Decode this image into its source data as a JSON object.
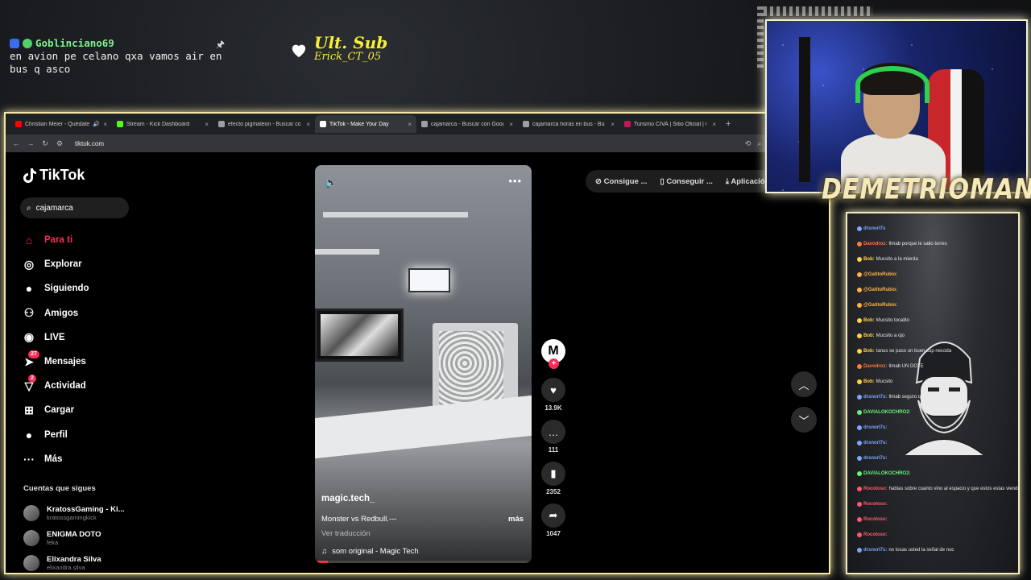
{
  "overlay": {
    "top_chat": {
      "username": "Goblinciano69",
      "message": "en avion pe celano qxa vamos air en bus q asco",
      "pin": "🖈"
    },
    "ult_sub": {
      "title": "Ult. Sub",
      "name": "Erick_CT_05"
    },
    "streamer_name": "DEMETRIOMAN",
    "streamer_suffix": "...."
  },
  "browser": {
    "tabs": [
      {
        "label": "Christian Meier - Quédate",
        "fav_color": "#ff0000",
        "active": false,
        "audio": "🔊"
      },
      {
        "label": "Stream - Kick Dashboard",
        "fav_color": "#53fc18",
        "active": false
      },
      {
        "label": "efecto pigmaleon - Buscar con",
        "fav_color": "#9aa0a6",
        "active": false
      },
      {
        "label": "TikTok - Make Your Day",
        "fav_color": "#ffffff",
        "active": true
      },
      {
        "label": "cajamarca - Buscar con Google",
        "fav_color": "#9aa0a6",
        "active": false
      },
      {
        "label": "cajamarca horas en bus - Busc",
        "fav_color": "#9aa0a6",
        "active": false
      },
      {
        "label": "Turismo CIVA | Sitio Oficial | Co",
        "fav_color": "#c2185b",
        "active": false
      }
    ],
    "new_tab": "+",
    "url": "tiktok.com"
  },
  "tiktok": {
    "logo": "TikTok",
    "search_value": "cajamarca",
    "nav": [
      {
        "label": "Para ti",
        "icon": "home-icon",
        "glyph": "⌂",
        "active": true
      },
      {
        "label": "Explorar",
        "icon": "compass-icon",
        "glyph": "◎"
      },
      {
        "label": "Siguiendo",
        "icon": "following-avatar-icon",
        "glyph": "●"
      },
      {
        "label": "Amigos",
        "icon": "friends-icon",
        "glyph": "⚇"
      },
      {
        "label": "LIVE",
        "icon": "live-icon",
        "glyph": "◉"
      },
      {
        "label": "Mensajes",
        "icon": "messages-icon",
        "glyph": "➤",
        "badge": "27"
      },
      {
        "label": "Actividad",
        "icon": "activity-icon",
        "glyph": "▽",
        "badge": "2"
      },
      {
        "label": "Cargar",
        "icon": "upload-icon",
        "glyph": "⊞"
      },
      {
        "label": "Perfil",
        "icon": "profile-icon",
        "glyph": "●"
      },
      {
        "label": "Más",
        "icon": "more-icon",
        "glyph": "···"
      }
    ],
    "following_heading": "Cuentas que sigues",
    "following": [
      {
        "name": "KratossGaming - Ki...",
        "handle": "kratossgamingkick"
      },
      {
        "name": "ENIGMA DOTO",
        "handle": "feka"
      },
      {
        "name": "Elixandra Silva",
        "handle": "elixandra.silva"
      }
    ],
    "video": {
      "author": "magic.tech_",
      "description": "Monster vs Redbull.---",
      "more": "más",
      "translate": "Ver traducción",
      "sound": "som original - Magic Tech",
      "progress": 0.06
    },
    "actions": {
      "avatar_letter": "M",
      "likes": "13.9K",
      "comments": "111",
      "saves": "2352",
      "shares": "1047"
    },
    "top_pills": [
      "Consigue ...",
      "Conseguir ...",
      "Aplicación"
    ]
  },
  "chat_panel": {
    "messages": [
      {
        "user": "drsnorl7s",
        "text": "",
        "color": "#7aa8ff"
      },
      {
        "user": "Davodroz:",
        "text": "Ilmab porque le salio torres",
        "color": "#ff7a3a"
      },
      {
        "user": "Bob:",
        "text": "Mucsito a la mierda",
        "color": "#ffd24a"
      },
      {
        "user": "@GatitoRubio:",
        "text": "",
        "color": "#ffb347"
      },
      {
        "user": "@GatitoRubio:",
        "text": "",
        "color": "#ffb347"
      },
      {
        "user": "@GatitoRubio:",
        "text": "",
        "color": "#ffb347"
      },
      {
        "user": "Bob:",
        "text": "Mucsito tocalito",
        "color": "#ffd24a"
      },
      {
        "user": "Bob:",
        "text": "Mucsito a ojo",
        "color": "#ffd24a"
      },
      {
        "user": "Bob:",
        "text": "tanus se paso un buen cup necoda",
        "color": "#ffd24a"
      },
      {
        "user": "Davodroz:",
        "text": "Ilmab UN DOTE",
        "color": "#ff7a3a"
      },
      {
        "user": "Bob:",
        "text": "Mucsito",
        "color": "#ffd24a"
      },
      {
        "user": "drsnorl7s:",
        "text": "Ilmab seguro que pasa esa gracia",
        "color": "#7aa8ff"
      },
      {
        "user": "DAVIALOKOCHRO2:",
        "text": "",
        "color": "#6cf07a"
      },
      {
        "user": "drsnorl7s:",
        "text": "",
        "color": "#7aa8ff"
      },
      {
        "user": "drsnorl7s:",
        "text": "",
        "color": "#7aa8ff"
      },
      {
        "user": "drsnorl7s:",
        "text": "",
        "color": "#7aa8ff"
      },
      {
        "user": "DAVIALOKOCHRO2:",
        "text": "",
        "color": "#6cf07a"
      },
      {
        "user": "Rocotoso:",
        "text": "hablas sobre cuanto vino al espacio y que estos estas viendo su pasado?",
        "color": "#ff5a6a"
      },
      {
        "user": "Rocotoso:",
        "text": "",
        "color": "#ff5a6a"
      },
      {
        "user": "Rocotoso:",
        "text": "",
        "color": "#ff5a6a"
      },
      {
        "user": "Rocotoso:",
        "text": "",
        "color": "#ff5a6a"
      },
      {
        "user": "drsnorl7s:",
        "text": "no tocas usted la señal de noc",
        "color": "#7aa8ff"
      }
    ]
  }
}
